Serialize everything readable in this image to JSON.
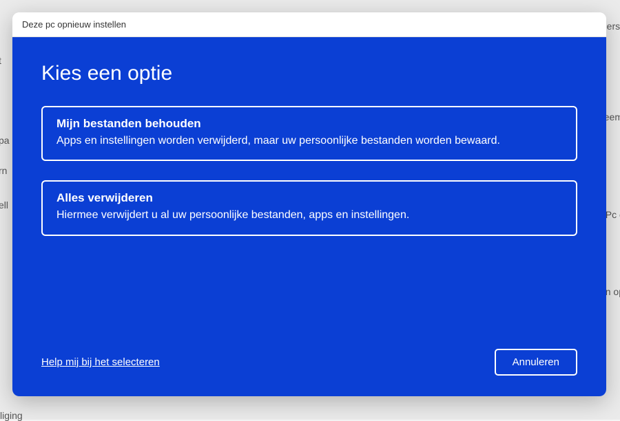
{
  "window": {
    "title": "Deze pc opnieuw instellen"
  },
  "dialog": {
    "heading": "Kies een optie",
    "options": [
      {
        "title": "Mijn bestanden behouden",
        "description": "Apps en instellingen worden verwijderd, maar uw persoonlijke bestanden worden bewaard."
      },
      {
        "title": "Alles verwijderen",
        "description": "Hiermee verwijdert u al uw persoonlijke bestanden, apps en instellingen."
      }
    ],
    "help_link": "Help mij bij het selecteren",
    "cancel_label": "Annuleren"
  },
  "background": {
    "fragments": [
      "t",
      "pa",
      "rn",
      "ell",
      "liging",
      "erst",
      "eem",
      "Pc c",
      "n op"
    ]
  }
}
